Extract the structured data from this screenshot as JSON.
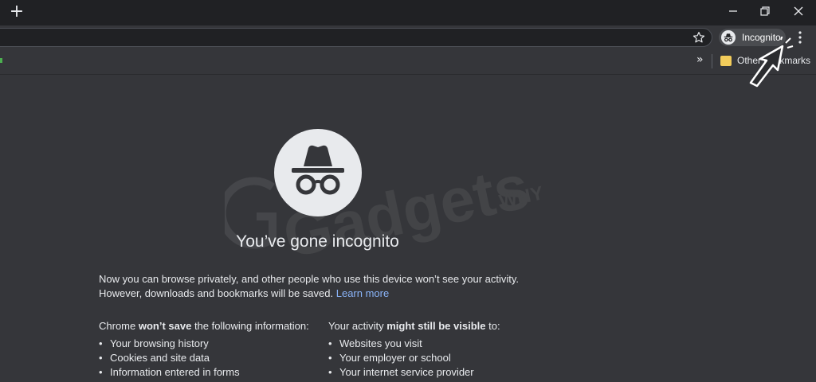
{
  "titlebar": {
    "new_tab_glyph": "+",
    "controls": [
      "minimize-icon",
      "restore-icon",
      "close-icon"
    ]
  },
  "toolbar": {
    "star_icon": "star-icon",
    "profile_label": "Incognito",
    "menu_icon": "more-vert-icon"
  },
  "bookmarks": {
    "overflow_glyph": "»",
    "folder_label": "Other bookmarks"
  },
  "page": {
    "title": "You’ve gone incognito",
    "intro_line1": "Now you can browse privately, and other people who use this device won’t see your activity.",
    "intro_line2": "However, downloads and bookmarks will be saved.",
    "learn_more": "Learn more",
    "left_col": {
      "head_pre": "Chrome ",
      "head_bold": "won’t save",
      "head_post": " the following information:",
      "items": [
        "Your browsing history",
        "Cookies and site data",
        "Information entered in forms"
      ]
    },
    "right_col": {
      "head_pre": "Your activity ",
      "head_bold": "might still be visible",
      "head_post": " to:",
      "items": [
        "Websites you visit",
        "Your employer or school",
        "Your internet service provider"
      ]
    }
  },
  "watermark": {
    "brand": "Gadgets",
    "sub": "WHY"
  },
  "colors": {
    "background": "#35363a",
    "titlebar": "#202124",
    "link": "#8ab4f8",
    "text": "#e8eaed"
  }
}
